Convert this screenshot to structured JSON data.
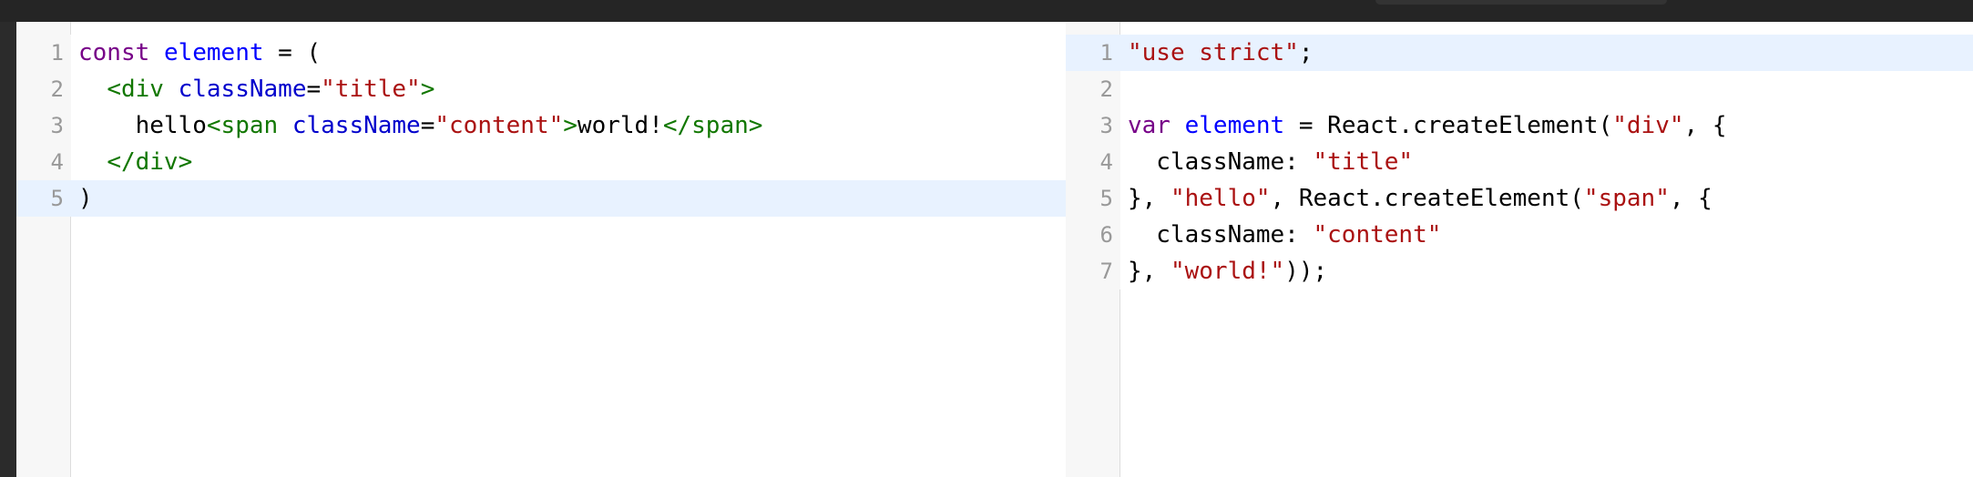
{
  "left_editor": {
    "lines": [
      {
        "num": "1",
        "tokens": [
          {
            "t": "const",
            "c": "kw"
          },
          {
            "t": " ",
            "c": "plain"
          },
          {
            "t": "element",
            "c": "var"
          },
          {
            "t": " = (",
            "c": "plain"
          }
        ]
      },
      {
        "num": "2",
        "tokens": [
          {
            "t": "  ",
            "c": "plain"
          },
          {
            "t": "<div",
            "c": "tag"
          },
          {
            "t": " ",
            "c": "plain"
          },
          {
            "t": "className",
            "c": "attr"
          },
          {
            "t": "=",
            "c": "plain"
          },
          {
            "t": "\"title\"",
            "c": "str"
          },
          {
            "t": ">",
            "c": "tag"
          }
        ]
      },
      {
        "num": "3",
        "tokens": [
          {
            "t": "    hello",
            "c": "plain"
          },
          {
            "t": "<span",
            "c": "tag"
          },
          {
            "t": " ",
            "c": "plain"
          },
          {
            "t": "className",
            "c": "attr"
          },
          {
            "t": "=",
            "c": "plain"
          },
          {
            "t": "\"content\"",
            "c": "str"
          },
          {
            "t": ">",
            "c": "tag"
          },
          {
            "t": "world!",
            "c": "plain"
          },
          {
            "t": "</span>",
            "c": "tag"
          }
        ]
      },
      {
        "num": "4",
        "tokens": [
          {
            "t": "  ",
            "c": "plain"
          },
          {
            "t": "</div>",
            "c": "tag"
          }
        ]
      },
      {
        "num": "5",
        "active": true,
        "tokens": [
          {
            "t": ")",
            "c": "plain"
          }
        ]
      }
    ]
  },
  "right_editor": {
    "lines": [
      {
        "num": "1",
        "active": true,
        "tokens": [
          {
            "t": "\"use strict\"",
            "c": "str"
          },
          {
            "t": ";",
            "c": "plain"
          }
        ]
      },
      {
        "num": "2",
        "tokens": []
      },
      {
        "num": "3",
        "tokens": [
          {
            "t": "var",
            "c": "kw"
          },
          {
            "t": " ",
            "c": "plain"
          },
          {
            "t": "element",
            "c": "var"
          },
          {
            "t": " = React.createElement(",
            "c": "plain"
          },
          {
            "t": "\"div\"",
            "c": "str"
          },
          {
            "t": ", {",
            "c": "plain"
          }
        ]
      },
      {
        "num": "4",
        "tokens": [
          {
            "t": "  className: ",
            "c": "plain"
          },
          {
            "t": "\"title\"",
            "c": "str"
          }
        ]
      },
      {
        "num": "5",
        "tokens": [
          {
            "t": "}, ",
            "c": "plain"
          },
          {
            "t": "\"hello\"",
            "c": "str"
          },
          {
            "t": ", React.createElement(",
            "c": "plain"
          },
          {
            "t": "\"span\"",
            "c": "str"
          },
          {
            "t": ", {",
            "c": "plain"
          }
        ]
      },
      {
        "num": "6",
        "tokens": [
          {
            "t": "  className: ",
            "c": "plain"
          },
          {
            "t": "\"content\"",
            "c": "str"
          }
        ]
      },
      {
        "num": "7",
        "tokens": [
          {
            "t": "}, ",
            "c": "plain"
          },
          {
            "t": "\"world!\"",
            "c": "str"
          },
          {
            "t": "));",
            "c": "plain"
          }
        ]
      }
    ]
  }
}
